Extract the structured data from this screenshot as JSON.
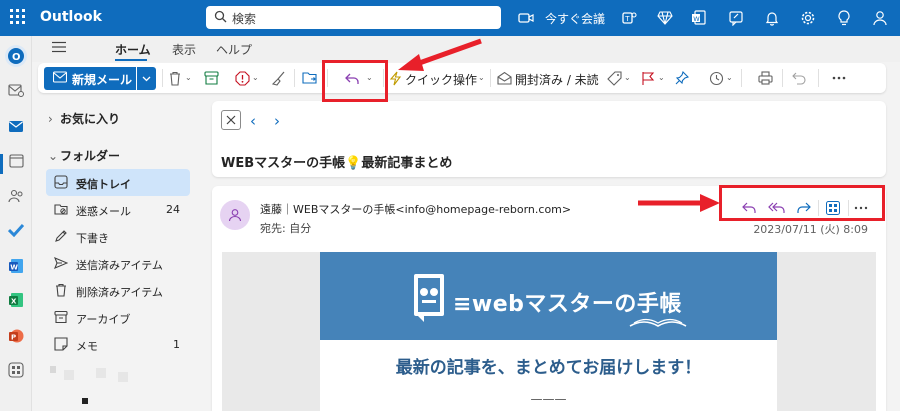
{
  "app": {
    "name": "Outlook"
  },
  "search": {
    "placeholder": "検索"
  },
  "topbar": {
    "meet_now_label": "今すぐ会議"
  },
  "tabs": [
    {
      "label": "ホーム",
      "active": true
    },
    {
      "label": "表示",
      "active": false
    },
    {
      "label": "ヘルプ",
      "active": false
    }
  ],
  "ribbon": {
    "new_mail_label": "新規メール",
    "quick_steps_label": "クイック操作",
    "read_unread_label": "開封済み / 未読"
  },
  "sidebar": {
    "favorites_label": "お気に入り",
    "folders_label": "フォルダー",
    "items": [
      {
        "label": "受信トレイ",
        "count": "",
        "icon": "inbox-icon",
        "selected": true
      },
      {
        "label": "迷惑メール",
        "count": "24",
        "icon": "junk-icon",
        "selected": false
      },
      {
        "label": "下書き",
        "count": "",
        "icon": "draft-icon",
        "selected": false
      },
      {
        "label": "送信済みアイテム",
        "count": "",
        "icon": "sent-icon",
        "selected": false
      },
      {
        "label": "削除済みアイテム",
        "count": "",
        "icon": "trash-icon",
        "selected": false
      },
      {
        "label": "アーカイブ",
        "count": "",
        "icon": "archive-icon",
        "selected": false
      },
      {
        "label": "メモ",
        "count": "1",
        "icon": "note-icon",
        "selected": false
      }
    ]
  },
  "message": {
    "subject": "WEBマスターの手帳💡最新記事まとめ",
    "sender": "遠藤｜WEBマスターの手帳<info@homepage-reborn.com>",
    "to_label": "宛先: ",
    "to_value": "自分",
    "date": "2023/07/11 (火) 8:09"
  },
  "newsletter": {
    "logo_text": "≡webマスターの手帳",
    "headline": "最新の記事を、まとめてお届けします！",
    "divider": "———"
  },
  "colors": {
    "brand": "#0f6cbd",
    "highlight": "#e8202a",
    "selected_folder": "#cfe4fa",
    "newsletter_header": "#4583b9",
    "newsletter_title": "#2c5d8c"
  }
}
